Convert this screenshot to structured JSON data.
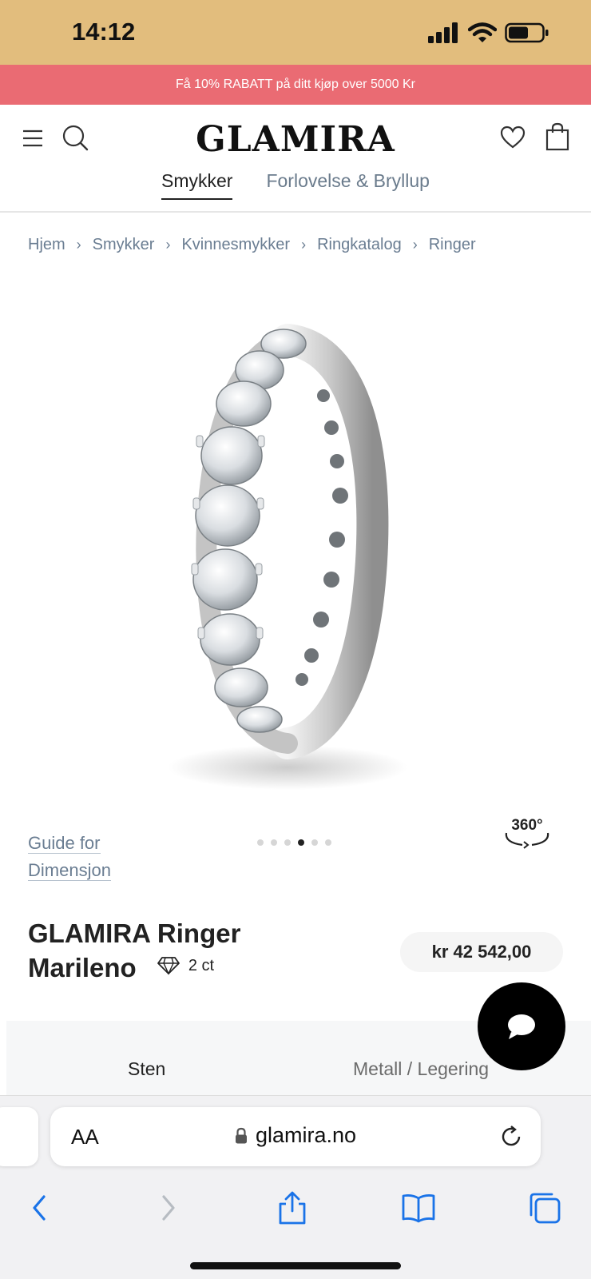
{
  "status_bar": {
    "time": "14:12",
    "battery_level": 0.6
  },
  "promo": {
    "text": "Få 10% RABATT på ditt kjøp over 5000 Kr"
  },
  "header": {
    "logo": "GLAMIRA",
    "tabs": [
      {
        "label": "Smykker",
        "active": true
      },
      {
        "label": "Forlovelse & Bryllup",
        "active": false
      }
    ]
  },
  "breadcrumb": [
    "Hjem",
    "Smykker",
    "Kvinnesmykker",
    "Ringkatalog",
    "Ringer"
  ],
  "gallery": {
    "guide_line1": "Guide for",
    "guide_line2": "Dimensjon",
    "dots_count": 6,
    "active_dot": 3,
    "label_360": "360°"
  },
  "product": {
    "title_line1": "GLAMIRA Ringer",
    "title_line2": "Marileno",
    "carat": "2 ct",
    "price": "kr 42 542,00"
  },
  "spec_tabs": [
    "Sten",
    "Metall / Legering"
  ],
  "browser": {
    "aa_label": "AA",
    "url": "glamira.no"
  },
  "colors": {
    "status_bar": "#e2bd7d",
    "promo_bar": "#ea6b73",
    "link_gray_blue": "#6a7d92",
    "ios_blue": "#1a73e8"
  }
}
